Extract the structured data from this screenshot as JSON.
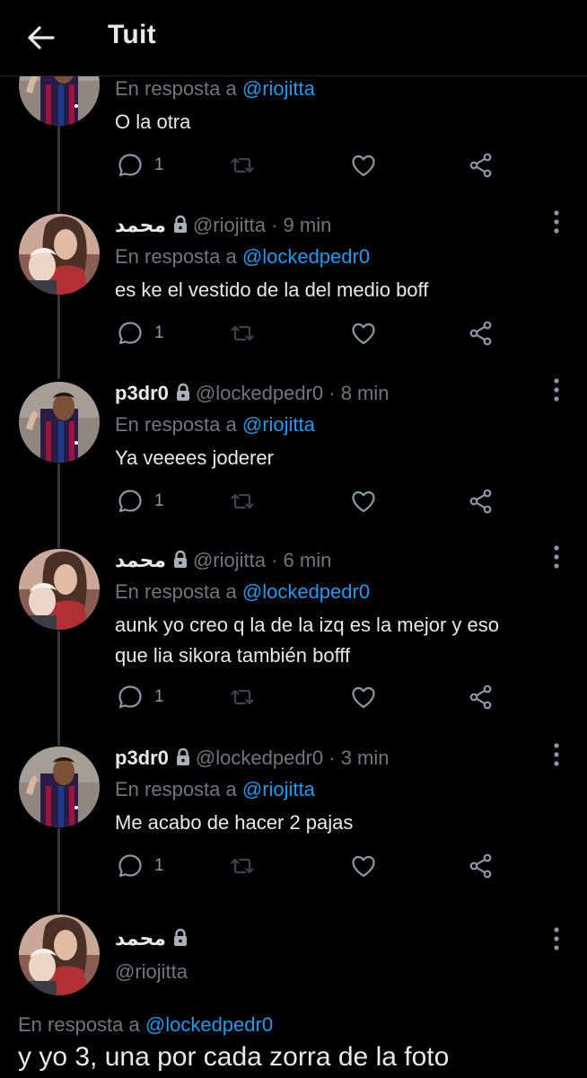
{
  "header": {
    "title": "Tuit"
  },
  "labels": {
    "replying_to": "En resposta a "
  },
  "tweets": [
    {
      "reply_to": "@riojitta",
      "text": "O la otra",
      "replies": "1"
    },
    {
      "name": "محمد",
      "handle": "@riojitta",
      "time": "· 9 min",
      "reply_to": "@lockedpedr0",
      "text": "es ke el vestido de la del medio boff",
      "replies": "1"
    },
    {
      "name": "p3dr0",
      "handle": "@lockedpedr0",
      "time": "· 8 min",
      "reply_to": "@riojitta",
      "text": "Ya veeees joderer",
      "replies": "1"
    },
    {
      "name": "محمد",
      "handle": "@riojitta",
      "time": "· 6 min",
      "reply_to": "@lockedpedr0",
      "text_line1": "aunk yo creo q la de la izq es la mejor y eso",
      "text_line2": "que lia sikora también bofff",
      "replies": "1"
    },
    {
      "name": "p3dr0",
      "handle": "@lockedpedr0",
      "time": "· 3 min",
      "reply_to": "@riojitta",
      "text": "Me acabo de hacer 2 pajas",
      "replies": "1"
    }
  ],
  "main_tweet": {
    "name": "محمد",
    "handle": "@riojitta",
    "reply_to": "@lockedpedr0",
    "text": "y yo 3, una por cada zorra de la foto"
  },
  "colors": {
    "background": "#000000",
    "text": "#e7e9ea",
    "muted": "#71767b",
    "link": "#1d9bf0"
  }
}
